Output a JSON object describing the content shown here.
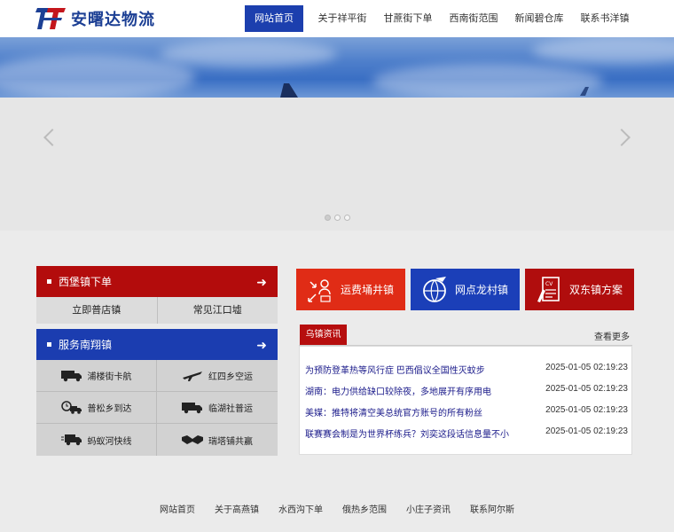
{
  "brand": {
    "name": "安曙达物流",
    "color_blue": "#1c3f94",
    "color_red": "#c4161c"
  },
  "nav": {
    "items": [
      {
        "label": "网站首页",
        "active": true
      },
      {
        "label": "关于祥平街",
        "active": false
      },
      {
        "label": "甘蔗街下单",
        "active": false
      },
      {
        "label": "西南街范围",
        "active": false
      },
      {
        "label": "新闻碧仓库",
        "active": false
      },
      {
        "label": "联系书洋镇",
        "active": false
      }
    ]
  },
  "slider": {
    "dots": 3,
    "active_dot": 0
  },
  "panel_order": {
    "title": "西堡镇下单",
    "buttons": [
      "立即普店镇",
      "常见江口墟"
    ]
  },
  "panel_service": {
    "title": "服务南翔镇",
    "items": [
      {
        "label": "浦楼街卡航",
        "icon": "truck-icon"
      },
      {
        "label": "红四乡空运",
        "icon": "airplane-icon"
      },
      {
        "label": "普松乡到达",
        "icon": "clock-truck-icon"
      },
      {
        "label": "临湖社普运",
        "icon": "truck-icon"
      },
      {
        "label": "蚂蚁河快线",
        "icon": "fast-truck-icon"
      },
      {
        "label": "瑞塔铺共赢",
        "icon": "handshake-icon"
      }
    ]
  },
  "features": [
    {
      "label": "运费埇井镇",
      "icon": "person-arrows-icon",
      "color": "#e02c16"
    },
    {
      "label": "网点龙村镇",
      "icon": "globe-plane-icon",
      "color": "#1b3fb8"
    },
    {
      "label": "双东镇方案",
      "icon": "document-pen-icon",
      "color": "#b00d0d"
    }
  ],
  "news": {
    "tab": "乌镇资讯",
    "more": "查看更多",
    "items": [
      {
        "title": "为预防登革热等风行症 巴西倡议全国性灭蚊步",
        "date": "2025-01-05 02:19:23"
      },
      {
        "title": "湖南：电力供给缺口较除夜，多地展开有序用电",
        "date": "2025-01-05 02:19:23"
      },
      {
        "title": "美媒：推特将清空美总统官方账号的所有粉丝",
        "date": "2025-01-05 02:19:23"
      },
      {
        "title": "联赛赛会制是为世界杯练兵？刘奕这段话信息量不小",
        "date": "2025-01-05 02:19:23"
      }
    ]
  },
  "footer": {
    "links": [
      "网站首页",
      "关于高燕镇",
      "水西沟下单",
      "俄热乡范围",
      "小庄子资讯",
      "联系阿尔斯"
    ]
  }
}
